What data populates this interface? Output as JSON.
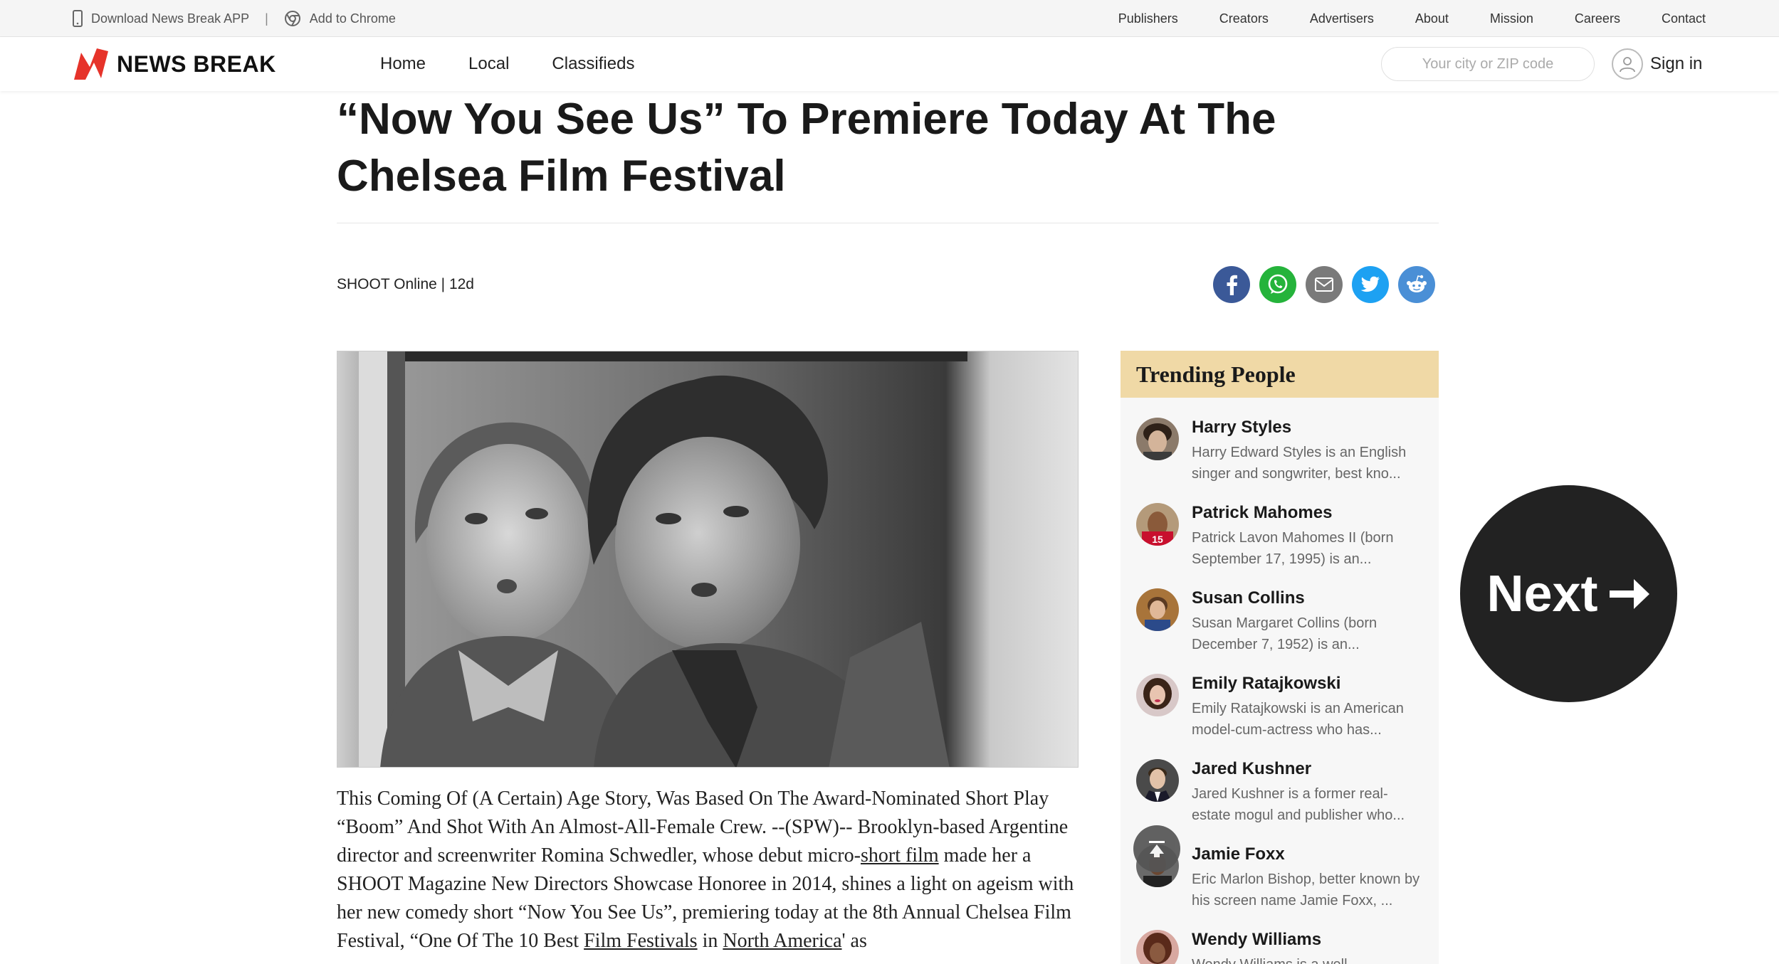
{
  "topbar": {
    "download_app": "Download News Break APP",
    "separator": "|",
    "add_to_chrome": "Add to Chrome",
    "links": [
      "Publishers",
      "Creators",
      "Advertisers",
      "About",
      "Mission",
      "Careers",
      "Contact"
    ]
  },
  "header": {
    "logo_text": "NEWS BREAK",
    "nav": [
      "Home",
      "Local",
      "Classifieds"
    ],
    "search_placeholder": "Your city or ZIP code",
    "sign_in": "Sign in"
  },
  "article": {
    "title": "“Now You See Us” To Premiere Today At The Chelsea Film Festival",
    "byline": "SHOOT Online | 12d",
    "share_icons": [
      "facebook-icon",
      "whatsapp-icon",
      "email-icon",
      "twitter-icon",
      "reddit-icon"
    ],
    "body": {
      "p1": "This Coming Of (A Certain) Age Story, Was Based On The Award-Nominated Short Play “Boom” And Shot With An Almost-All-Female Crew. --(SPW)-- Brooklyn-based Argentine director and screenwriter Romina Schwedler, whose debut micro-",
      "link1": "short film",
      "p2": " made her a SHOOT Magazine New Directors Showcase Honoree in 2014, shines a light on ageism with her new comedy short “Now You See Us”, premiering today at the 8th Annual Chelsea Film Festival, “One Of The 10 Best ",
      "link2": "Film Festivals",
      "p3": " in ",
      "link3": "North America",
      "p4": "' as"
    }
  },
  "sidebar": {
    "title": "Trending People",
    "people": [
      {
        "name": "Harry Styles",
        "desc": "Harry Edward Styles is an English singer and songwriter, best kno..."
      },
      {
        "name": "Patrick Mahomes",
        "desc": "Patrick Lavon Mahomes II (born September 17, 1995) is an..."
      },
      {
        "name": "Susan Collins",
        "desc": "Susan Margaret Collins (born December 7, 1952) is an..."
      },
      {
        "name": "Emily Ratajkowski",
        "desc": "Emily Ratajkowski is an American model-cum-actress who has..."
      },
      {
        "name": "Jared Kushner",
        "desc": "Jared Kushner is a former real-estate mogul and publisher who..."
      },
      {
        "name": "Jamie Foxx",
        "desc": "Eric Marlon Bishop, better known by his screen name Jamie Foxx, ..."
      },
      {
        "name": "Wendy Williams",
        "desc": "Wendy Williams is a well..."
      }
    ]
  },
  "next_button": "Next",
  "colors": {
    "logo_red": "#e6332a",
    "trending_header": "#f0d9a6",
    "facebook": "#3b5998",
    "whatsapp": "#25b33b",
    "email": "#7a7a7a",
    "twitter": "#1da1f2",
    "reddit": "#4a8fd6",
    "next_button": "#222222"
  }
}
